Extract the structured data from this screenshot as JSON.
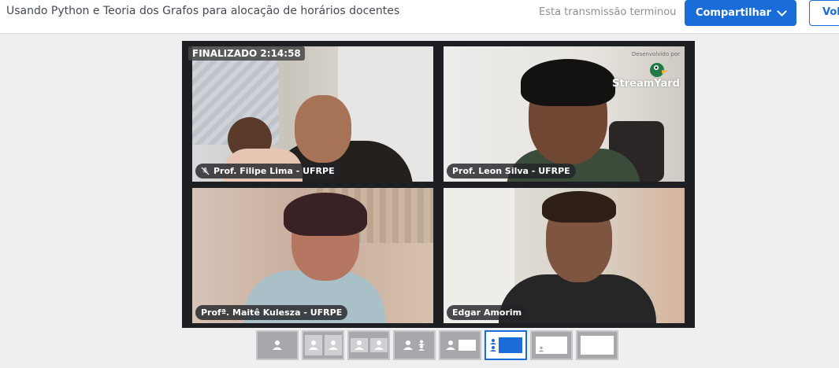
{
  "header": {
    "title": "Usando Python e Teoria dos Grafos para alocação de horários docentes",
    "status": "Esta transmissão terminou",
    "share_label": "Compartilhar",
    "back_label": "Vol"
  },
  "stage": {
    "badge": "FINALIZADO 2:14:58",
    "participants": [
      {
        "name": "Prof. Filipe Lima - UFRPE",
        "muted": true
      },
      {
        "name": "Prof. Leon Silva - UFRPE",
        "muted": false
      },
      {
        "name": "Profª. Maitê Kulesza - UFRPE",
        "muted": false
      },
      {
        "name": "Edgar Amorim",
        "muted": false
      }
    ],
    "logo_caption": "Desenvolvido por",
    "logo_text": "StreamYard"
  },
  "layouts": {
    "selected_index": 5,
    "items": [
      "solo",
      "grupo",
      "grupo-cinza",
      "lado-a-lado",
      "destaque",
      "destaque-compartilhado",
      "fundo",
      "tela-cheia"
    ]
  },
  "colors": {
    "accent": "#1a6dd8",
    "stage_bg": "#1d1f22",
    "page_bg": "#eeeff1"
  }
}
